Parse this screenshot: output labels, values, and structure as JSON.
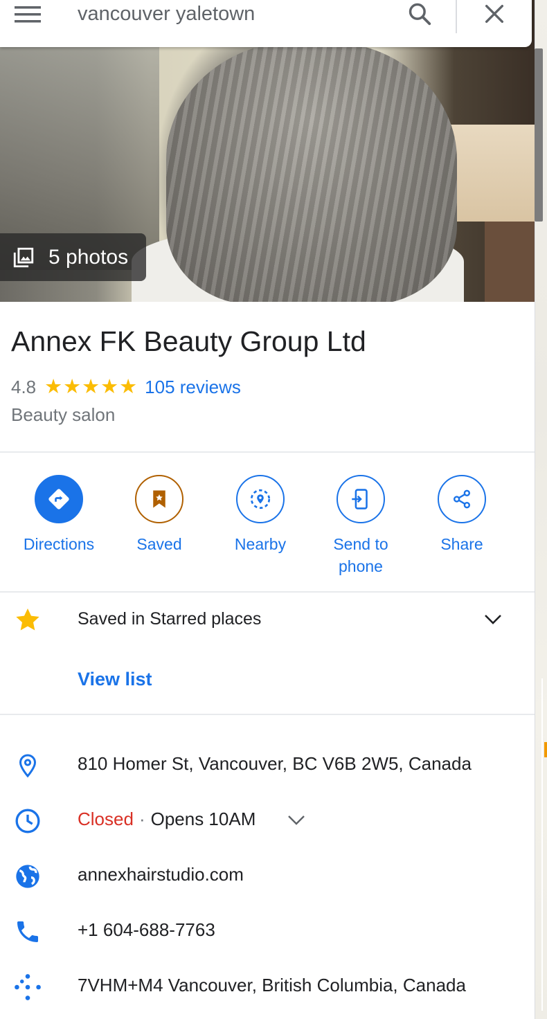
{
  "search": {
    "query": "vancouver yaletown"
  },
  "hero": {
    "photos_label": "5 photos"
  },
  "place": {
    "name": "Annex FK Beauty Group Ltd",
    "rating": "4.8",
    "stars": 4.8,
    "reviews_label": "105 reviews",
    "category": "Beauty salon"
  },
  "actions": [
    {
      "label": "Directions",
      "icon": "directions-icon"
    },
    {
      "label": "Saved",
      "icon": "bookmark-icon"
    },
    {
      "label": "Nearby",
      "icon": "nearby-icon"
    },
    {
      "label": "Send to phone",
      "icon": "send-to-phone-icon"
    },
    {
      "label": "Share",
      "icon": "share-icon"
    }
  ],
  "saved": {
    "text": "Saved in Starred places",
    "view_list": "View list"
  },
  "info": {
    "address": "810 Homer St, Vancouver, BC V6B 2W5, Canada",
    "status": "Closed",
    "separator": "·",
    "hours": "Opens 10AM",
    "website": "annexhairstudio.com",
    "phone": "+1 604-688-7763",
    "plus_code": "7VHM+M4 Vancouver, British Columbia, Canada"
  },
  "colors": {
    "accent": "#1a73e8",
    "star": "#fbbc04",
    "closed": "#d93025",
    "saved_accent": "#b06000"
  }
}
